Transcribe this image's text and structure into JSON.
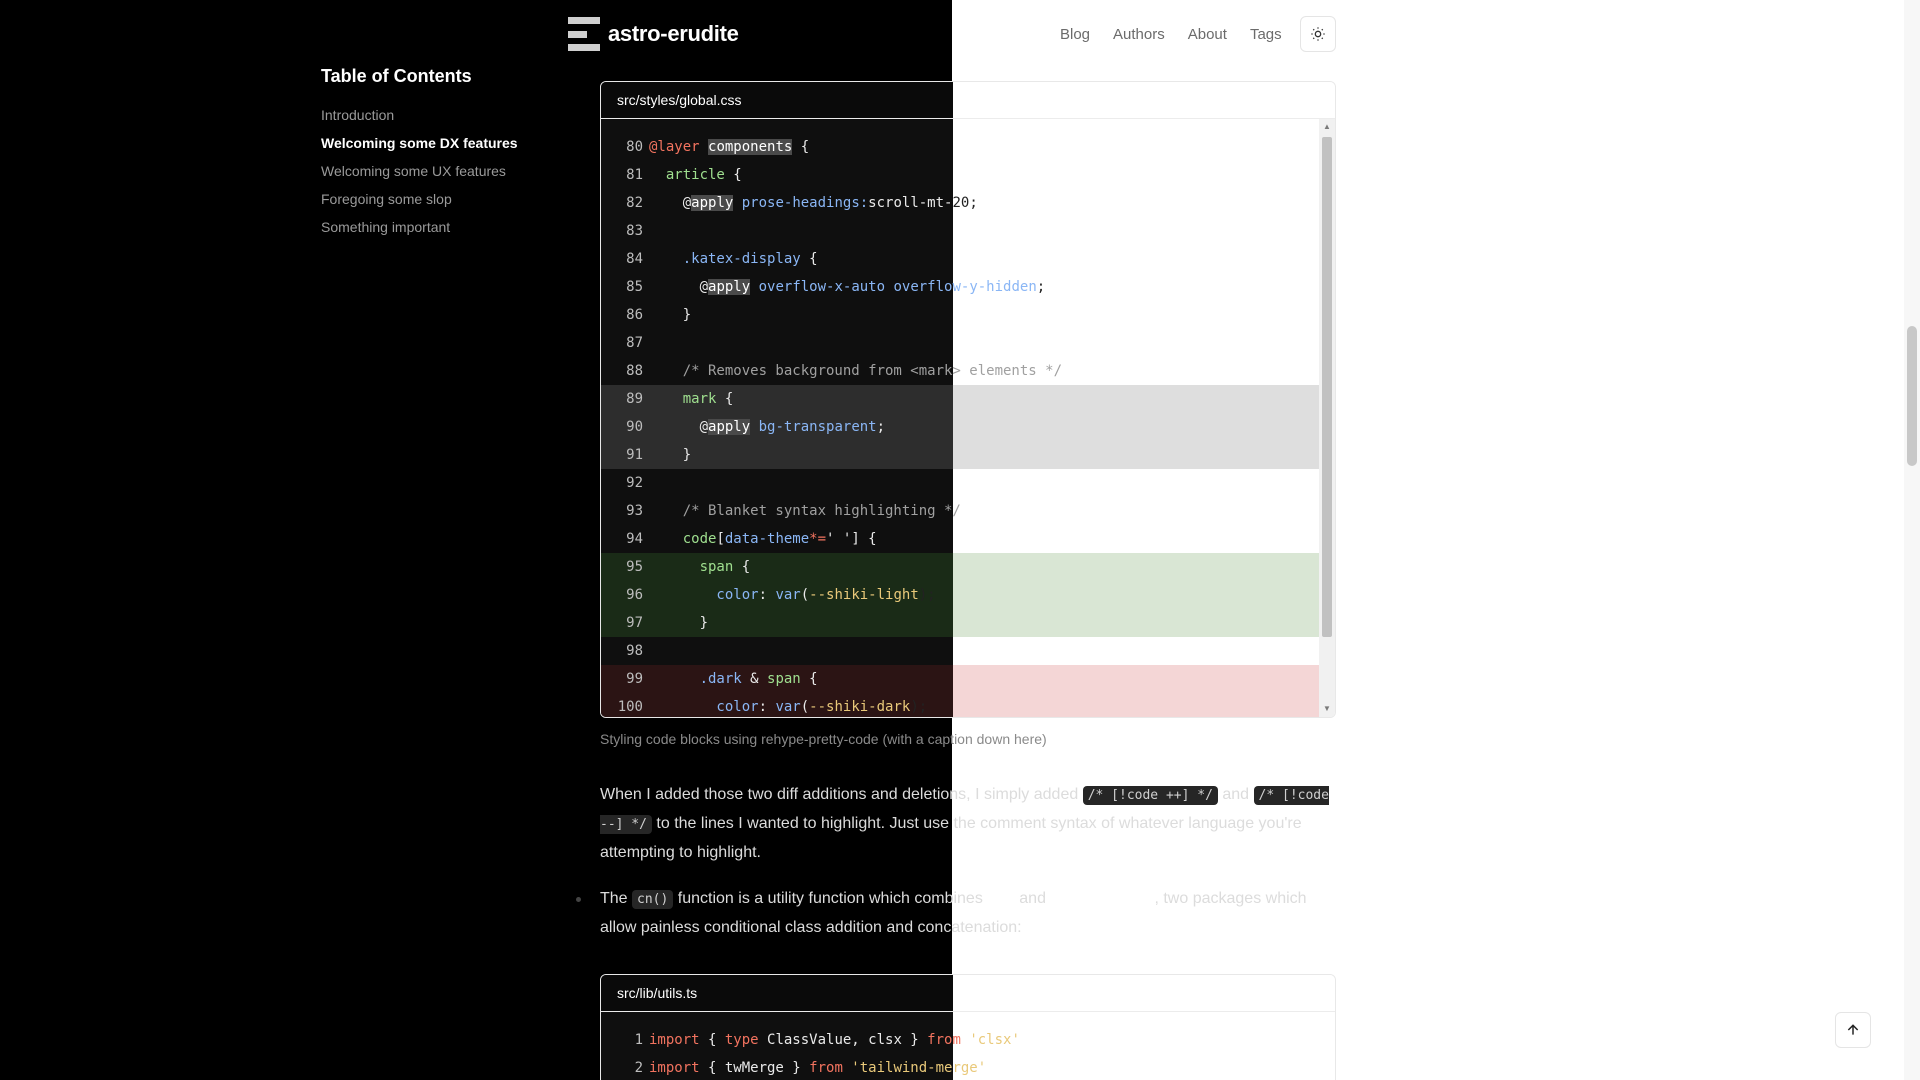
{
  "site": {
    "title": "astro-erudite"
  },
  "nav": {
    "items": [
      "Blog",
      "Authors",
      "About",
      "Tags"
    ]
  },
  "toc": {
    "title": "Table of Contents",
    "items": [
      "Introduction",
      "Welcoming some DX features",
      "Welcoming some UX features",
      "Foregoing some slop",
      "Something important"
    ],
    "active_index": 1
  },
  "code_block_1": {
    "filename": "src/styles/global.css",
    "caption": "Styling code blocks using rehype-pretty-code (with a caption down here)",
    "line_numbers": [
      "80",
      "81",
      "82",
      "83",
      "84",
      "85",
      "86",
      "87",
      "88",
      "89",
      "90",
      "91",
      "92",
      "93",
      "94",
      "95",
      "96",
      "97",
      "98",
      "99",
      "100"
    ]
  },
  "prose": {
    "p1_a": "When I added those two diff additions and deletions, I simply added ",
    "p1_code1": "/* [!code ++] */",
    "p1_b": " and ",
    "p1_code2": "/* [!code --] */",
    "p1_c": " to the lines I wanted to highlight. Just use the comment syntax of whatever language you're attempting to highlight.",
    "p2_a": "The ",
    "p2_code": "cn()",
    "p2_b": " function is a utility function which combines ",
    "p2_link1": "clsx",
    "p2_c": " and ",
    "p2_link2": "tailwind-merge",
    "p2_d": ", two packages which allow painless conditional class addition and concatenation:"
  },
  "code_block_2": {
    "filename": "src/lib/utils.ts",
    "line_numbers": [
      "1",
      "2"
    ]
  },
  "colors": {
    "background_dark": "#000000",
    "background_light": "#ffffff",
    "accent_add": "#d9e6d4",
    "accent_del": "#f4d6d6"
  }
}
